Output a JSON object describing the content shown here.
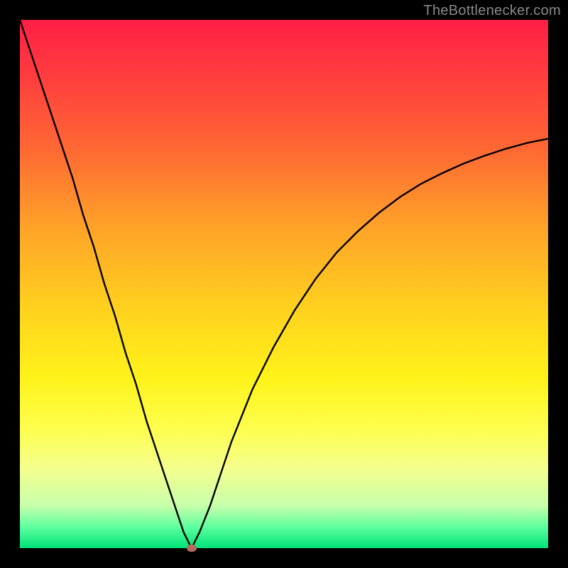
{
  "watermark": "TheBottlenecker.com",
  "chart_data": {
    "type": "line",
    "title": "",
    "xlabel": "",
    "ylabel": "",
    "xlim": [
      0,
      100
    ],
    "ylim": [
      0,
      100
    ],
    "grid": false,
    "series": [
      {
        "name": "curve",
        "x": [
          0,
          2,
          4,
          6,
          8,
          10,
          12,
          14,
          16,
          18,
          20,
          22,
          24,
          26,
          28,
          30,
          31,
          32,
          32.5,
          33,
          34,
          36,
          38,
          40,
          44,
          48,
          52,
          56,
          60,
          64,
          68,
          72,
          76,
          80,
          84,
          88,
          92,
          96,
          100
        ],
        "y": [
          100,
          94,
          88,
          82,
          76,
          70,
          63,
          57,
          50,
          44,
          37,
          31,
          24,
          18,
          12,
          6,
          3,
          1,
          0,
          1,
          3,
          8,
          14,
          20,
          30,
          38,
          45,
          51,
          56,
          60,
          63.5,
          66.5,
          69,
          71,
          72.8,
          74.3,
          75.6,
          76.7,
          77.5
        ]
      }
    ],
    "marker": {
      "x": 32.5,
      "y": 0
    },
    "gradient_stops": [
      {
        "pos": 0,
        "color": "#ff1f47"
      },
      {
        "pos": 25,
        "color": "#ff6a33"
      },
      {
        "pos": 55,
        "color": "#ffd21e"
      },
      {
        "pos": 78,
        "color": "#fdff52"
      },
      {
        "pos": 96,
        "color": "#5dff9e"
      },
      {
        "pos": 100,
        "color": "#00e37a"
      }
    ]
  }
}
